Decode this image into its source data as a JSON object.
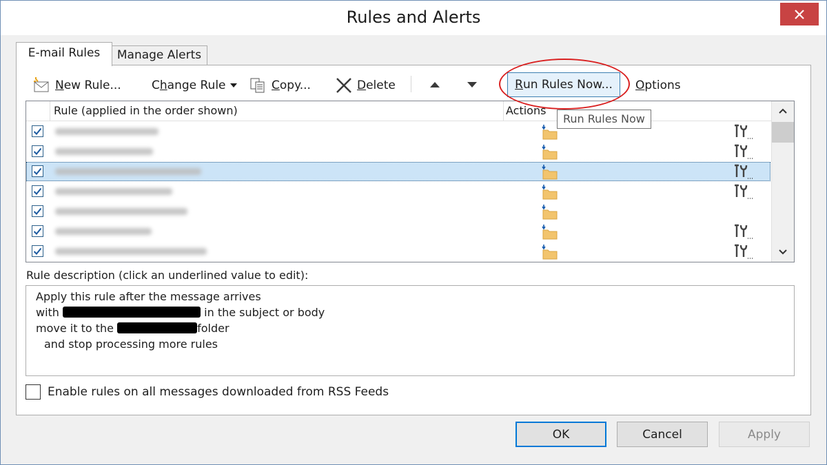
{
  "window": {
    "title": "Rules and Alerts"
  },
  "tabs": [
    {
      "label": "E-mail Rules",
      "active": true
    },
    {
      "label": "Manage Alerts",
      "active": false
    }
  ],
  "toolbar": {
    "new_rule": {
      "underline": "N",
      "rest": "ew Rule..."
    },
    "change_rule": {
      "pre": "C",
      "underline": "h",
      "rest": "ange Rule"
    },
    "copy": {
      "underline": "C",
      "rest": "opy..."
    },
    "delete": {
      "underline": "D",
      "rest": "elete"
    },
    "run_rules_now": {
      "underline": "R",
      "rest": "un Rules Now..."
    },
    "options": {
      "underline": "O",
      "rest": "ptions"
    }
  },
  "tooltip": "Run Rules Now",
  "list": {
    "columns": [
      "Rule (applied in the order shown)",
      "Actions"
    ],
    "rows": [
      {
        "checked": true,
        "selected": false,
        "name_hidden": true,
        "has_move_action": true,
        "has_tool_icon": true
      },
      {
        "checked": true,
        "selected": false,
        "name_hidden": true,
        "has_move_action": true,
        "has_tool_icon": true
      },
      {
        "checked": true,
        "selected": true,
        "name_hidden": true,
        "has_move_action": true,
        "has_tool_icon": true
      },
      {
        "checked": true,
        "selected": false,
        "name_hidden": true,
        "has_move_action": true,
        "has_tool_icon": true
      },
      {
        "checked": true,
        "selected": false,
        "name_hidden": true,
        "has_move_action": true,
        "has_tool_icon": false
      },
      {
        "checked": true,
        "selected": false,
        "name_hidden": true,
        "has_move_action": true,
        "has_tool_icon": true
      },
      {
        "checked": true,
        "selected": false,
        "name_hidden": true,
        "has_move_action": true,
        "has_tool_icon": true
      }
    ]
  },
  "description": {
    "label": "Rule description (click an underlined value to edit):",
    "line1": "Apply this rule after the message arrives",
    "line2_pre": "with",
    "line2_post": "in the subject or body",
    "line3_pre": "move it to the",
    "line3_post": "folder",
    "line4": "and stop processing more rules"
  },
  "rss": {
    "label": "Enable rules on all messages downloaded from RSS Feeds",
    "checked": false
  },
  "buttons": {
    "ok": "OK",
    "cancel": "Cancel",
    "apply": "Apply"
  },
  "colors": {
    "accent": "#0078d7",
    "highlight_ring": "#d92020",
    "close_bg": "#c84343",
    "selected_row": "#cce4f7"
  }
}
